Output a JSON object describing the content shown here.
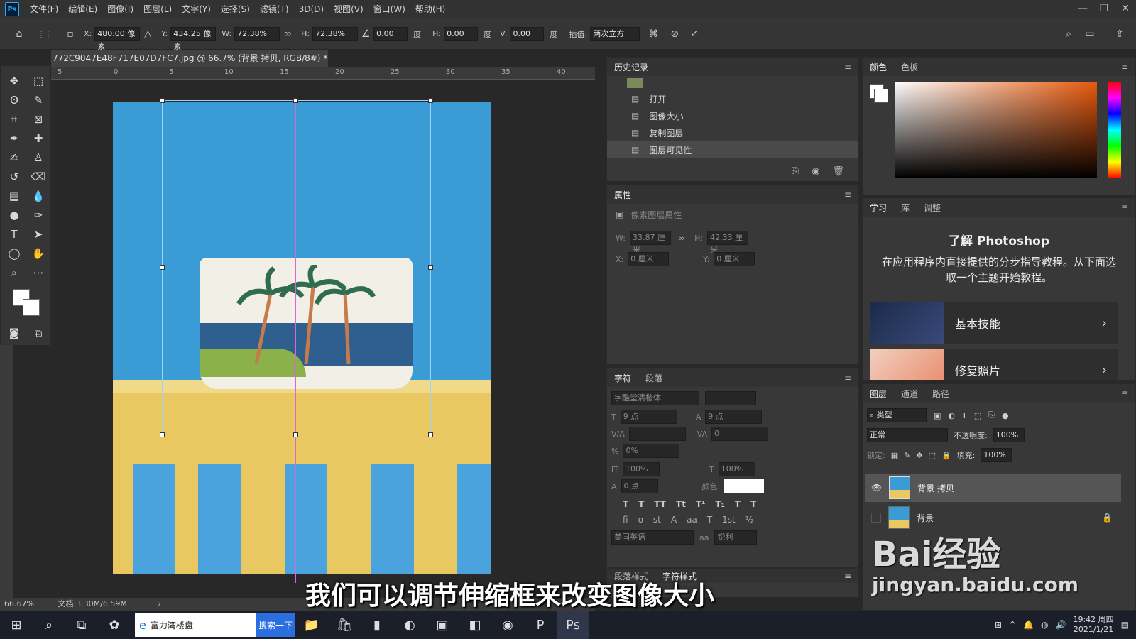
{
  "menubar": {
    "logo": "Ps",
    "items": [
      "文件(F)",
      "编辑(E)",
      "图像(I)",
      "图层(L)",
      "文字(Y)",
      "选择(S)",
      "滤镜(T)",
      "3D(D)",
      "视图(V)",
      "窗口(W)",
      "帮助(H)"
    ]
  },
  "options": {
    "x_label": "X:",
    "x_value": "480.00 像素",
    "y_label": "Y:",
    "y_value": "434.25 像素",
    "w_label": "W:",
    "w_value": "72.38%",
    "h_label": "H:",
    "h_value": "72.38%",
    "angle_value": "0.00",
    "deg": "度",
    "hskew_label": "H:",
    "hskew_value": "0.00",
    "vskew_label": "V:",
    "vskew_value": "0.00",
    "interp_label": "插值:",
    "interp_value": "两次立方"
  },
  "document": {
    "tab_title": "772C9047E48F717E07D7FC7.jpg @ 66.7% (背景 拷贝, RGB/8#) *",
    "zoom": "66.67%",
    "doc_size": "文档:3.30M/6.59M",
    "ruler_labels": [
      "5",
      "0",
      "5",
      "10",
      "15",
      "20",
      "25",
      "30",
      "35",
      "40"
    ]
  },
  "history": {
    "title": "历史记录",
    "items": [
      "打开",
      "图像大小",
      "复制图层",
      "图层可见性"
    ]
  },
  "properties": {
    "title": "属性",
    "subtitle": "像素图层属性",
    "w_label": "W:",
    "w_value": "33.87 厘米",
    "h_label": "H:",
    "h_value": "42.33 厘米",
    "x_label": "X:",
    "x_value": "0 厘米",
    "y_label": "Y:",
    "y_value": "0 厘米"
  },
  "character": {
    "tab1": "字符",
    "tab2": "段落",
    "font_family": "字酷堂清楷体",
    "size": "9 点",
    "leading": "9 点",
    "tracking": "0",
    "scale_v": "100%",
    "scale_h": "100%",
    "baseline": "0 点",
    "percent": "0%",
    "color_label": "颜色:",
    "language": "美国英语",
    "aa_label": "aa",
    "aa_value": "锐利",
    "bottom_tab1": "段落样式",
    "bottom_tab2": "字符样式"
  },
  "color": {
    "tab1": "颜色",
    "tab2": "色板"
  },
  "learn": {
    "tab1": "学习",
    "tab2": "库",
    "tab3": "调整",
    "heading": "了解 Photoshop",
    "desc": "在应用程序内直接提供的分步指导教程。从下面选取一个主题开始教程。",
    "card1": "基本技能",
    "card2": "修复照片"
  },
  "layers": {
    "tab1": "图层",
    "tab2": "通道",
    "tab3": "路径",
    "filter": "类型",
    "blend": "正常",
    "opacity_label": "不透明度:",
    "opacity": "100%",
    "lock_label": "锁定:",
    "fill_label": "填充:",
    "fill": "100%",
    "items": [
      "背景 拷贝",
      "背景"
    ]
  },
  "caption": "我们可以调节伸缩框来改变图像大小",
  "taskbar": {
    "search_text": "富力湾楼盘",
    "search_btn": "搜索一下",
    "time": "19:42 周四",
    "date": "2021/1/21"
  },
  "watermark": {
    "line1": "Bai经验",
    "line2": "jingyan.baidu.com"
  }
}
